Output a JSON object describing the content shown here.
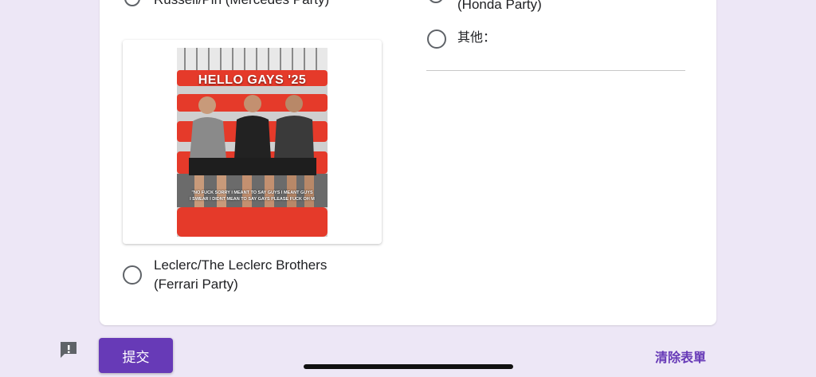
{
  "options": {
    "russell_label": "Russell/Pin (Mercedes Party)",
    "honda_label": "(Honda Party)",
    "other_label": "其他：",
    "leclerc_line1": "Leclerc/The Leclerc Brothers",
    "leclerc_line2": "(Ferrari Party)"
  },
  "image": {
    "caption": "HELLO GAYS '25",
    "subtitle_line1": "\"NO FUCK SORRY I MEANT TO SAY GUYS I MEANT GUYS",
    "subtitle_line2": "I SWEAR I DIDNT MEAN TO SAY GAYS PLEASE FUCK OH M"
  },
  "footer": {
    "submit_label": "提交",
    "clear_label": "清除表單"
  },
  "colors": {
    "accent": "#673ab7",
    "background": "#ede7f6"
  }
}
